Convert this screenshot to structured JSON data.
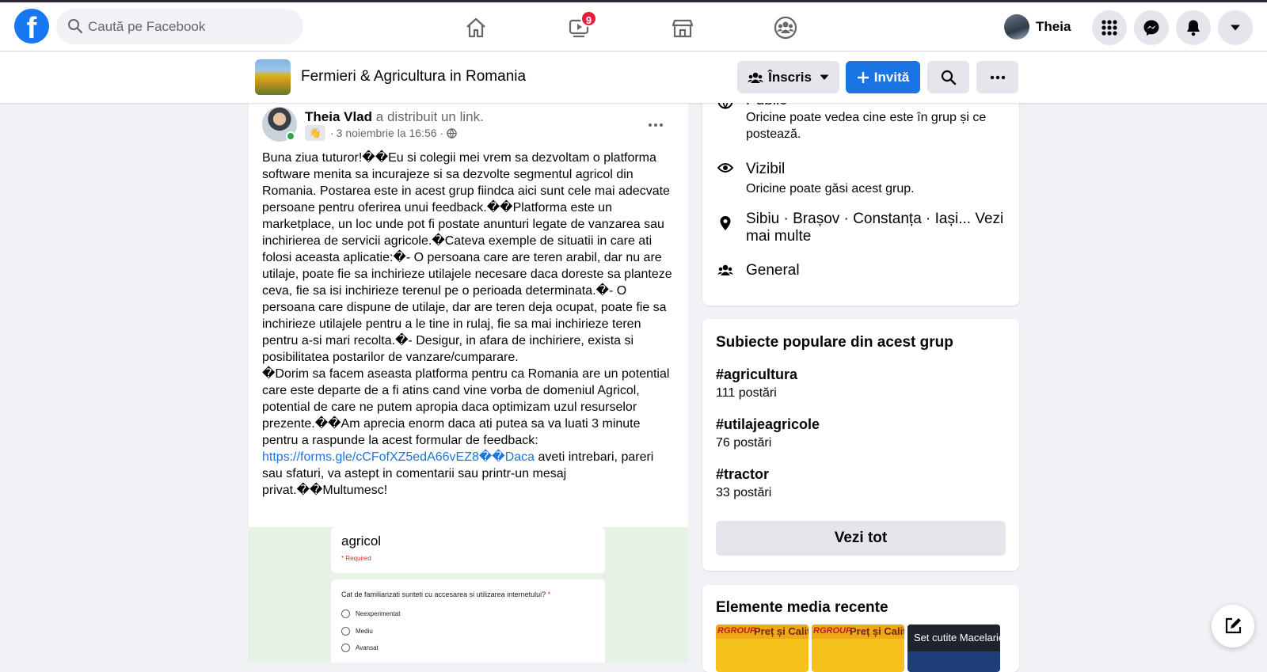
{
  "topnav": {
    "logo_letter": "f",
    "search_placeholder": "Caută pe Facebook",
    "watch_badge": "9",
    "profile_name": "Theia"
  },
  "group": {
    "title": "Fermieri & Agricultura in Romania",
    "joined_label": "Înscris",
    "invite_label": "Invită"
  },
  "post": {
    "author": "Theia Vlad",
    "action": "a distribuit un link.",
    "date": "3 noiembrie la 16:56",
    "body_before_link": "Buna ziua tuturor!��Eu si colegii mei vrem sa dezvoltam o platforma software menita sa incurajeze si sa dezvolte segmentul agricol din Romania. Postarea este in acest grup fiindca aici sunt cele mai adecvate persoane pentru oferirea unui feedback.��Platforma este un marketplace, un loc unde pot fi postate anunturi legate de vanzarea sau inchirierea de servicii agricole.�Cateva exemple de situatii in care ati folosi aceasta aplicatie:�- O persoana care are teren arabil, dar nu are utilaje, poate fie sa inchirieze utilajele necesare daca doreste sa planteze ceva, fie sa isi inchirieze terenul pe o perioada determinata.�- O persoana care dispune de utilaje, dar are teren deja ocupat, poate fie sa inchirieze utilajele pentru a le tine in rulaj, fie sa mai inchirieze teren pentru a-si mari recolta.�- Desigur, in afara de inchiriere, exista si posibilitatea postarilor de vanzare/cumparare.\n�Dorim sa facem aseasta platforma pentru ca Romania are un potential care este departe de a fi atins cand vine vorba de domeniul Agricol, potential de care ne putem apropia daca optimizam uzul resurselor prezente.��Am aprecia enorm daca ati putea sa va luati 3 minute pentru a raspunde la acest formular de feedback: ",
    "link": "https://forms.gle/cCFofXZ5edA66vEZ8��Daca",
    "body_after_link": " aveti intrebari, pareri sau sfaturi, va astept in comentarii sau printr-un mesaj privat.��Multumesc!",
    "preview": {
      "form_title": "agricol",
      "required": "* Required",
      "question": "Cat de familiarizati sunteti cu accesarea si utilizarea internetului?",
      "question_star": " *",
      "options": [
        "Neexperimentat",
        "Mediu",
        "Avansat"
      ]
    }
  },
  "about": {
    "privacy_title": "Public",
    "privacy_desc": "Oricine poate vedea cine este în grup și ce postează.",
    "visible_title": "Vizibil",
    "visible_desc": "Oricine poate găsi acest grup.",
    "locations": "Sibiu · Brașov · Constanța · Iași... Vezi mai multe",
    "type": "General"
  },
  "topics": {
    "title": "Subiecte populare din acest grup",
    "items": [
      {
        "tag": "#agricultura",
        "count": "111 postări"
      },
      {
        "tag": "#utilajeagricole",
        "count": "76 postări"
      },
      {
        "tag": "#tractor",
        "count": "33 postări"
      }
    ],
    "see_all": "Vezi tot"
  },
  "media": {
    "title": "Elemente media recente",
    "thumbs": [
      {
        "brand": "RGROUP",
        "text": "Preț și Calit"
      },
      {
        "brand": "RGROUP",
        "text": "Preț și Calit"
      },
      {
        "text": "Set cutite Macelarie"
      }
    ]
  }
}
